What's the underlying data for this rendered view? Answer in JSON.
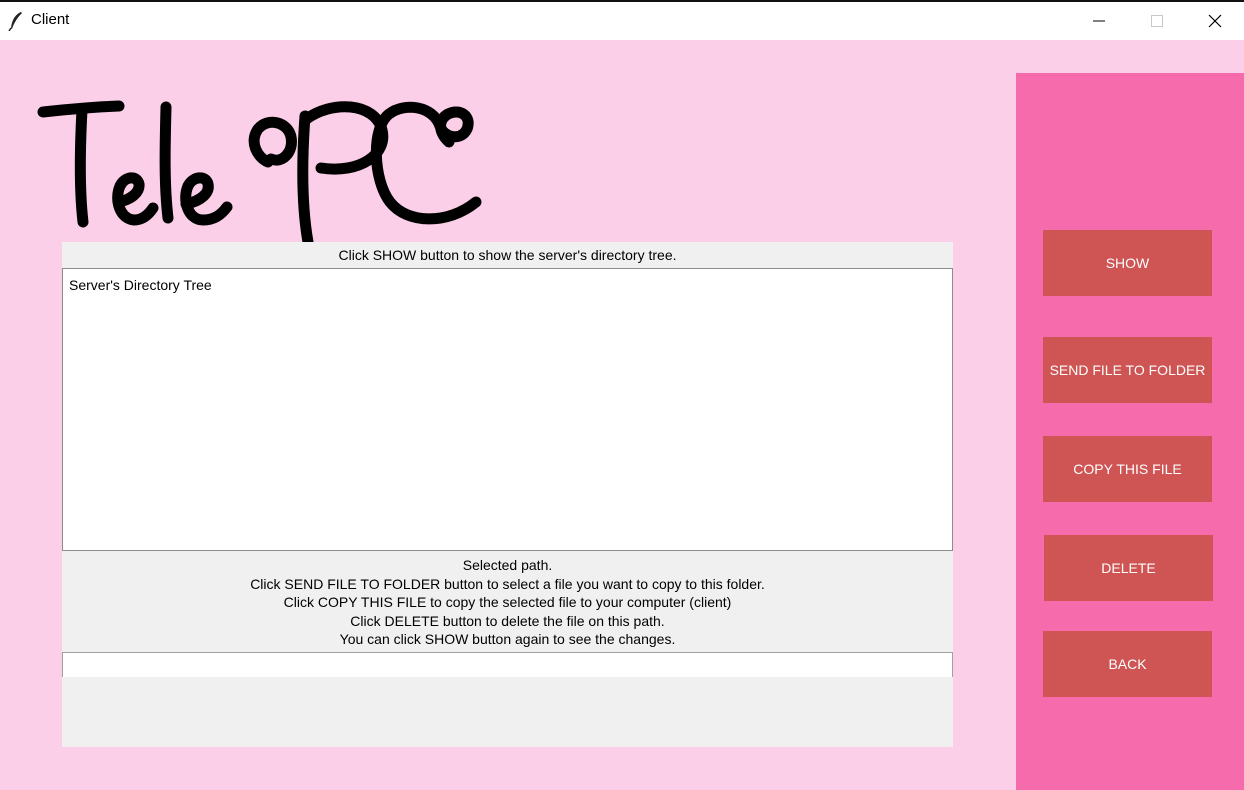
{
  "window": {
    "title": "Client",
    "icon": "feather-icon",
    "controls": [
      "minimize-icon",
      "maximize-icon",
      "close-icon"
    ]
  },
  "logo": {
    "text": "TelePC"
  },
  "tree": {
    "hint": "Click SHOW button to show the server's directory tree.",
    "root_label": "Server's Directory Tree"
  },
  "instructions": {
    "lines": [
      "Selected path.",
      "Click SEND FILE TO FOLDER button to select a file you want to copy to this folder.",
      "Click COPY THIS FILE to copy the selected file to your computer (client)",
      "Click DELETE button to delete the file on this path.",
      "You can click SHOW button again to see the changes."
    ]
  },
  "path_input": {
    "value": ""
  },
  "buttons": {
    "show": "SHOW",
    "send": "SEND FILE TO FOLDER",
    "copy": "COPY THIS FILE",
    "delete": "DELETE",
    "back": "BACK"
  },
  "colors": {
    "background": "#fbcfe8",
    "side_panel": "#f56bab",
    "button": "#cf5454",
    "button_text": "#ffffff",
    "pane": "#f0f0f0"
  }
}
